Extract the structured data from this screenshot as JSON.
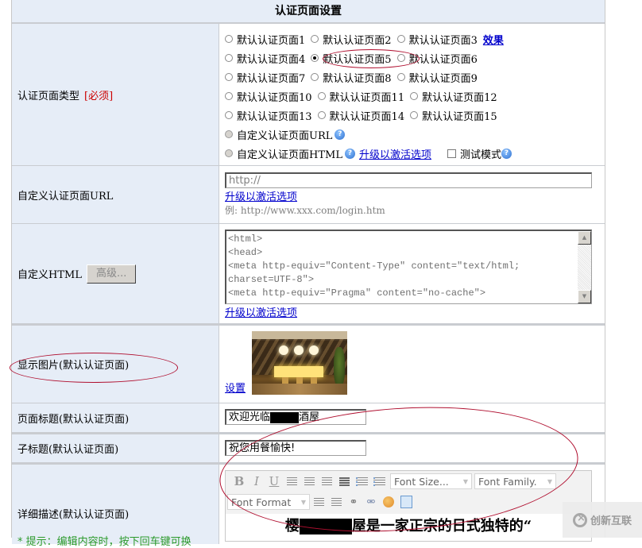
{
  "header": {
    "title": "认证页面设置"
  },
  "page_type": {
    "label": "认证页面类型",
    "required_tag": "[必须]",
    "options_rows": [
      [
        {
          "label": "默认认证页面1",
          "checked": false
        },
        {
          "label": "默认认证页面2",
          "checked": false
        },
        {
          "label": "默认认证页面3",
          "checked": false
        }
      ],
      [
        {
          "label": "默认认证页面4",
          "checked": false
        },
        {
          "label": "默认认证页面5",
          "checked": true
        },
        {
          "label": "默认认证页面6",
          "checked": false
        }
      ],
      [
        {
          "label": "默认认证页面7",
          "checked": false
        },
        {
          "label": "默认认证页面8",
          "checked": false
        },
        {
          "label": "默认认证页面9",
          "checked": false
        }
      ],
      [
        {
          "label": "默认认证页面10",
          "checked": false
        },
        {
          "label": "默认认证页面11",
          "checked": false
        },
        {
          "label": "默认认证页面12",
          "checked": false
        }
      ],
      [
        {
          "label": "默认认证页面13",
          "checked": false
        },
        {
          "label": "默认认证页面14",
          "checked": false
        },
        {
          "label": "默认认证页面15",
          "checked": false
        }
      ]
    ],
    "effect_link": "效果",
    "custom_url_option": "自定义认证页面URL",
    "custom_html_option": "自定义认证页面HTML",
    "upgrade_link": "升级以激活选项",
    "test_mode_label": "测试模式",
    "test_mode_checked": false,
    "help_icon": "?"
  },
  "custom_url": {
    "label": "自定义认证页面URL",
    "input_value": "http://",
    "upgrade_link": "升级以激活选项",
    "example": "例: http://www.xxx.com/login.htm"
  },
  "custom_html": {
    "label": "自定义HTML",
    "advanced_button": "高级...",
    "textarea_value": "<html>\n<head>\n<meta http-equiv=\"Content-Type\" content=\"text/html;\ncharset=UTF-8\">\n<meta http-equiv=\"Pragma\" content=\"no-cache\">",
    "upgrade_link": "升级以激活选项"
  },
  "display_image": {
    "label": "显示图片(默认认证页面)",
    "set_link": "设置"
  },
  "page_title": {
    "label": "页面标题(默认认证页面)",
    "value_prefix": "欢迎光临",
    "value_suffix": "酒屋"
  },
  "subtitle": {
    "label": "子标题(默认认证页面)",
    "value": "祝您用餐愉快!"
  },
  "description": {
    "label": "详细描述(默认认证页面)",
    "hint": "* 提示：编辑内容时，按下回车键可换",
    "toolbar": {
      "bold": "B",
      "italic": "I",
      "underline": "U",
      "font_size": "Font Size...",
      "font_family": "Font Family.",
      "font_format": "Font Format"
    },
    "body_text_start": "樱",
    "body_text_end": "屋是一家正宗的日式独特的“"
  },
  "watermark": {
    "text": "创新互联"
  }
}
